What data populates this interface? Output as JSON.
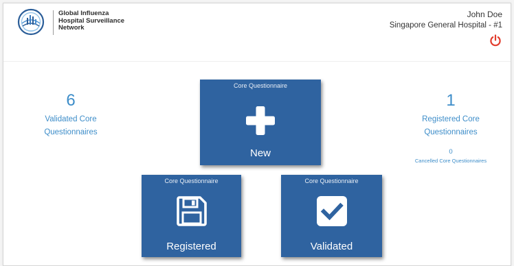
{
  "header": {
    "org_name_lines": [
      "Global Influenza",
      "Hospital Surveillance",
      "Network"
    ],
    "user_name": "John Doe",
    "hospital": "Singapore General Hospital - #1",
    "logout_icon": "power-icon"
  },
  "stats": {
    "validated": {
      "value": "6",
      "label_line1": "Validated Core",
      "label_line2": "Questionnaires"
    },
    "registered": {
      "value": "1",
      "label_line1": "Registered Core",
      "label_line2": "Questionnaires",
      "cancelled_value": "0",
      "cancelled_label": "Cancelled Core Questionnaires"
    }
  },
  "tiles": {
    "new": {
      "caption": "Core Questionnaire",
      "label": "New",
      "icon": "plus-icon"
    },
    "registered": {
      "caption": "Core Questionnaire",
      "label": "Registered",
      "icon": "floppy-disk-icon"
    },
    "validated": {
      "caption": "Core Questionnaire",
      "label": "Validated",
      "icon": "checkbox-icon"
    }
  },
  "colors": {
    "tile_background": "#2f63a0",
    "stat_text": "#3d8dc9",
    "logout_icon": "#e23c2c"
  }
}
